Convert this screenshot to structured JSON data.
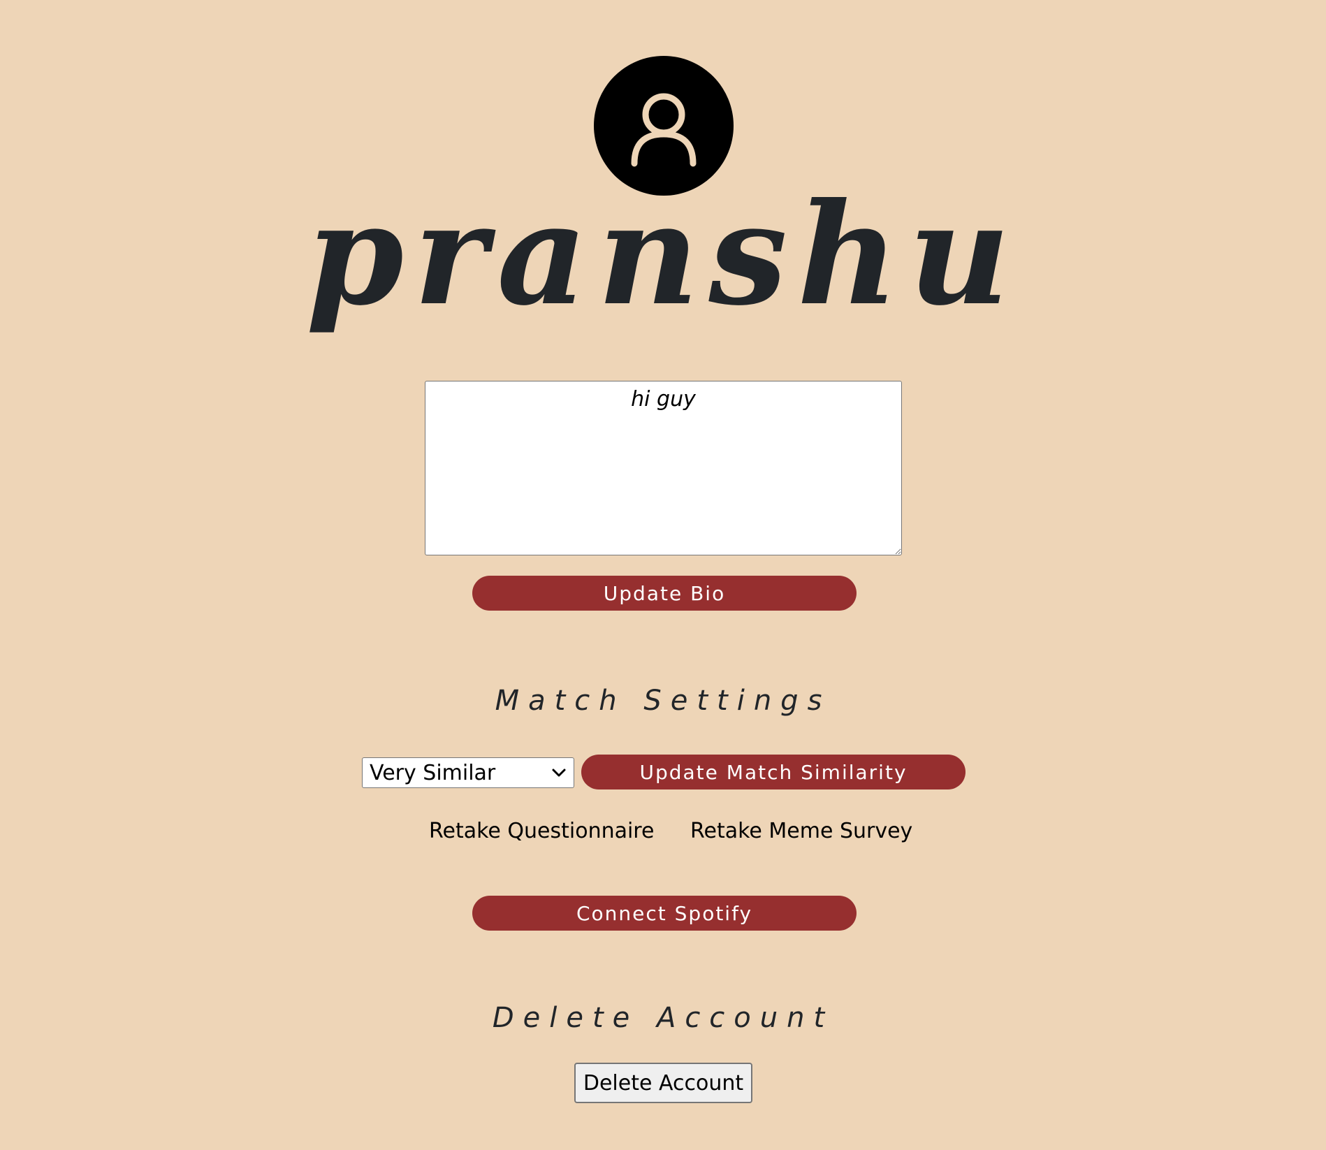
{
  "profile": {
    "avatar_icon": "user-icon",
    "username": "pranshu",
    "bio": "hi guy",
    "update_bio_label": "Update Bio"
  },
  "match_settings": {
    "heading": "Match Settings",
    "similarity_selected": "Very Similar",
    "update_similarity_label": "Update Match Similarity",
    "retake_questionnaire_label": "Retake Questionnaire",
    "retake_meme_survey_label": "Retake Meme Survey",
    "connect_spotify_label": "Connect Spotify"
  },
  "delete_account": {
    "heading": "Delete Account",
    "button_label": "Delete Account"
  },
  "colors": {
    "background": "#eed5b7",
    "accent": "#962f2f",
    "avatar_bg": "#000000",
    "avatar_fg": "#eed5b7"
  }
}
